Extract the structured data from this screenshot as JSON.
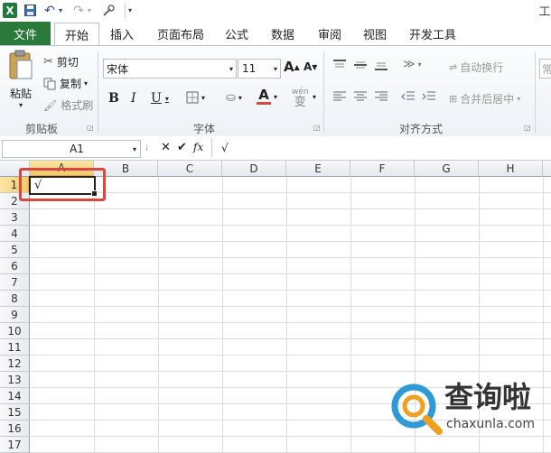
{
  "qat": {
    "app_icon": "X",
    "undo_icon": "↶",
    "redo_icon": "↷",
    "title_fragment": "工"
  },
  "tabs": [
    "文件",
    "开始",
    "插入",
    "页面布局",
    "公式",
    "数据",
    "审阅",
    "视图",
    "开发工具"
  ],
  "ribbon": {
    "clipboard": {
      "paste": "粘贴",
      "cut": "剪切",
      "copy": "复制",
      "format_painter": "格式刷",
      "group": "剪贴板"
    },
    "font": {
      "name": "宋体",
      "size": "11",
      "grow": "A",
      "shrink": "A",
      "bold": "B",
      "italic": "I",
      "underline": "U",
      "font_color": "A",
      "wen": "wén",
      "group": "字体"
    },
    "alignment": {
      "wrap": "自动换行",
      "merge": "合并后居中",
      "group": "对齐方式"
    },
    "number": {
      "fragment": "常"
    }
  },
  "formula_bar": {
    "name_box": "A1",
    "cancel": "✕",
    "enter": "✔",
    "fx": "fx",
    "value": "√"
  },
  "sheet": {
    "columns": [
      "A",
      "B",
      "C",
      "D",
      "E",
      "F",
      "G",
      "H"
    ],
    "rows": [
      "1",
      "2",
      "3",
      "4",
      "5",
      "6",
      "7",
      "8",
      "9",
      "10",
      "11",
      "12",
      "13",
      "14",
      "15",
      "16",
      "17"
    ],
    "cell_a1": "√"
  },
  "watermark": {
    "brand": "查询啦",
    "url": "chaxunla.com"
  },
  "colors": {
    "file_tab": "#2a7b3b",
    "highlight": "#d9473f",
    "selected_header": "#f6d27b"
  }
}
